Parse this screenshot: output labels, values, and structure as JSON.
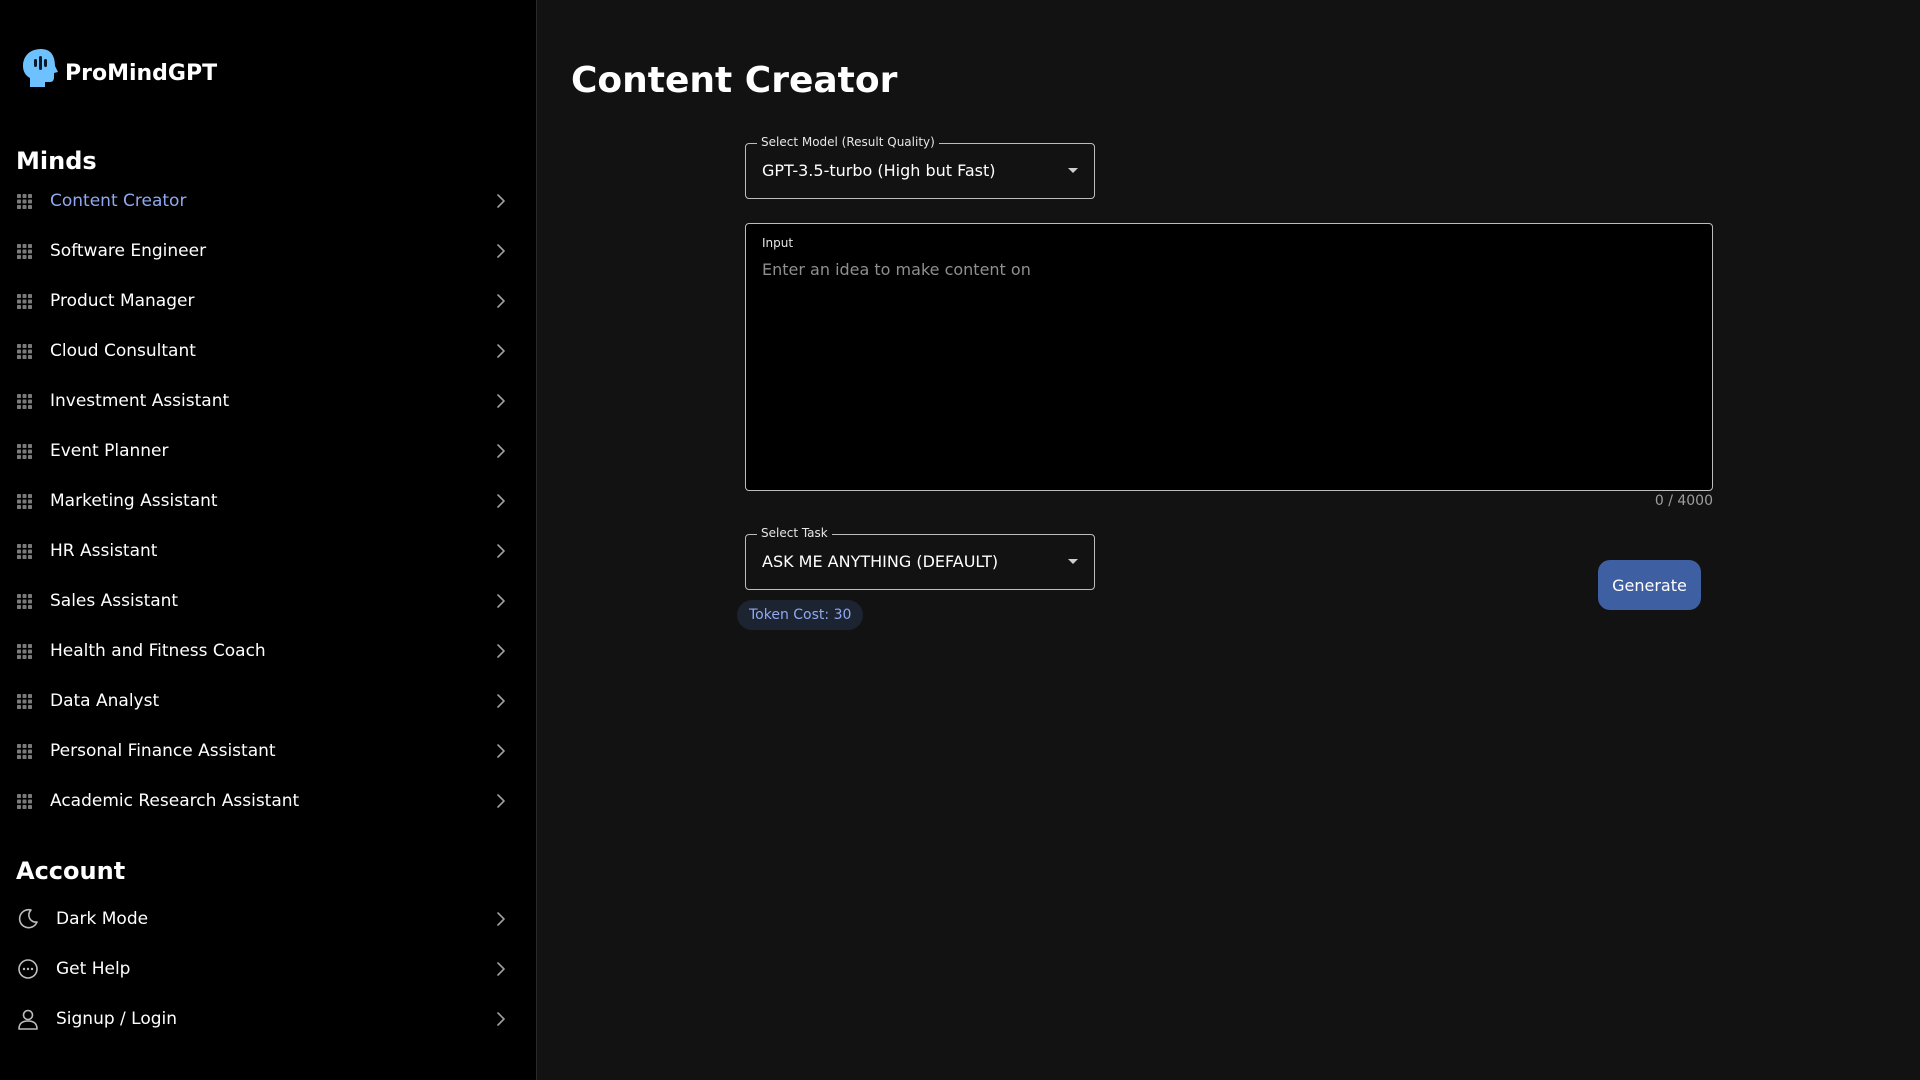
{
  "brand": {
    "name": "ProMindGPT",
    "logo_icon": "head-profile-icon"
  },
  "sidebar": {
    "minds_title": "Minds",
    "minds": [
      {
        "label": "Content Creator",
        "icon": "grid-icon",
        "active": true
      },
      {
        "label": "Software Engineer",
        "icon": "grid-icon"
      },
      {
        "label": "Product Manager",
        "icon": "grid-icon"
      },
      {
        "label": "Cloud Consultant",
        "icon": "grid-icon"
      },
      {
        "label": "Investment Assistant",
        "icon": "grid-icon"
      },
      {
        "label": "Event Planner",
        "icon": "grid-icon"
      },
      {
        "label": "Marketing Assistant",
        "icon": "grid-icon"
      },
      {
        "label": "HR Assistant",
        "icon": "grid-icon"
      },
      {
        "label": "Sales Assistant",
        "icon": "grid-icon"
      },
      {
        "label": "Health and Fitness Coach",
        "icon": "grid-icon"
      },
      {
        "label": "Data Analyst",
        "icon": "grid-icon"
      },
      {
        "label": "Personal Finance Assistant",
        "icon": "grid-icon"
      },
      {
        "label": "Academic Research Assistant",
        "icon": "grid-icon"
      }
    ],
    "account_title": "Account",
    "account": [
      {
        "label": "Dark Mode",
        "icon": "moon-icon"
      },
      {
        "label": "Get Help",
        "icon": "chat-bubble-icon"
      },
      {
        "label": "Signup / Login",
        "icon": "user-icon"
      }
    ]
  },
  "main": {
    "title": "Content Creator",
    "model_select": {
      "label": "Select Model (Result Quality)",
      "value": "GPT-3.5-turbo (High but Fast)"
    },
    "input": {
      "label": "Input",
      "placeholder": "Enter an idea to make content on",
      "value": "",
      "counter": "0 / 4000"
    },
    "task_select": {
      "label": "Select Task",
      "value": "ASK ME ANYTHING (DEFAULT)"
    },
    "token_cost": "Token Cost: 30",
    "generate_label": "Generate"
  },
  "colors": {
    "background": "#121212",
    "sidebar_bg": "#000000",
    "accent_text": "#90a8f0",
    "button_bg": "#3f5fa3",
    "chip_bg": "#1c2431"
  }
}
